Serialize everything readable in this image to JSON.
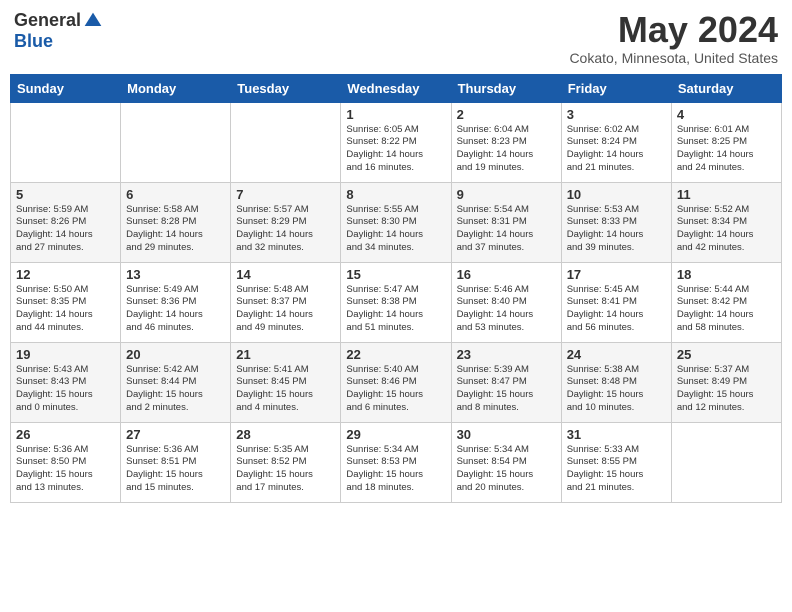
{
  "logo": {
    "general": "General",
    "blue": "Blue"
  },
  "header": {
    "month_title": "May 2024",
    "location": "Cokato, Minnesota, United States"
  },
  "days_of_week": [
    "Sunday",
    "Monday",
    "Tuesday",
    "Wednesday",
    "Thursday",
    "Friday",
    "Saturday"
  ],
  "weeks": [
    [
      {
        "day": "",
        "info": ""
      },
      {
        "day": "",
        "info": ""
      },
      {
        "day": "",
        "info": ""
      },
      {
        "day": "1",
        "info": "Sunrise: 6:05 AM\nSunset: 8:22 PM\nDaylight: 14 hours\nand 16 minutes."
      },
      {
        "day": "2",
        "info": "Sunrise: 6:04 AM\nSunset: 8:23 PM\nDaylight: 14 hours\nand 19 minutes."
      },
      {
        "day": "3",
        "info": "Sunrise: 6:02 AM\nSunset: 8:24 PM\nDaylight: 14 hours\nand 21 minutes."
      },
      {
        "day": "4",
        "info": "Sunrise: 6:01 AM\nSunset: 8:25 PM\nDaylight: 14 hours\nand 24 minutes."
      }
    ],
    [
      {
        "day": "5",
        "info": "Sunrise: 5:59 AM\nSunset: 8:26 PM\nDaylight: 14 hours\nand 27 minutes."
      },
      {
        "day": "6",
        "info": "Sunrise: 5:58 AM\nSunset: 8:28 PM\nDaylight: 14 hours\nand 29 minutes."
      },
      {
        "day": "7",
        "info": "Sunrise: 5:57 AM\nSunset: 8:29 PM\nDaylight: 14 hours\nand 32 minutes."
      },
      {
        "day": "8",
        "info": "Sunrise: 5:55 AM\nSunset: 8:30 PM\nDaylight: 14 hours\nand 34 minutes."
      },
      {
        "day": "9",
        "info": "Sunrise: 5:54 AM\nSunset: 8:31 PM\nDaylight: 14 hours\nand 37 minutes."
      },
      {
        "day": "10",
        "info": "Sunrise: 5:53 AM\nSunset: 8:33 PM\nDaylight: 14 hours\nand 39 minutes."
      },
      {
        "day": "11",
        "info": "Sunrise: 5:52 AM\nSunset: 8:34 PM\nDaylight: 14 hours\nand 42 minutes."
      }
    ],
    [
      {
        "day": "12",
        "info": "Sunrise: 5:50 AM\nSunset: 8:35 PM\nDaylight: 14 hours\nand 44 minutes."
      },
      {
        "day": "13",
        "info": "Sunrise: 5:49 AM\nSunset: 8:36 PM\nDaylight: 14 hours\nand 46 minutes."
      },
      {
        "day": "14",
        "info": "Sunrise: 5:48 AM\nSunset: 8:37 PM\nDaylight: 14 hours\nand 49 minutes."
      },
      {
        "day": "15",
        "info": "Sunrise: 5:47 AM\nSunset: 8:38 PM\nDaylight: 14 hours\nand 51 minutes."
      },
      {
        "day": "16",
        "info": "Sunrise: 5:46 AM\nSunset: 8:40 PM\nDaylight: 14 hours\nand 53 minutes."
      },
      {
        "day": "17",
        "info": "Sunrise: 5:45 AM\nSunset: 8:41 PM\nDaylight: 14 hours\nand 56 minutes."
      },
      {
        "day": "18",
        "info": "Sunrise: 5:44 AM\nSunset: 8:42 PM\nDaylight: 14 hours\nand 58 minutes."
      }
    ],
    [
      {
        "day": "19",
        "info": "Sunrise: 5:43 AM\nSunset: 8:43 PM\nDaylight: 15 hours\nand 0 minutes."
      },
      {
        "day": "20",
        "info": "Sunrise: 5:42 AM\nSunset: 8:44 PM\nDaylight: 15 hours\nand 2 minutes."
      },
      {
        "day": "21",
        "info": "Sunrise: 5:41 AM\nSunset: 8:45 PM\nDaylight: 15 hours\nand 4 minutes."
      },
      {
        "day": "22",
        "info": "Sunrise: 5:40 AM\nSunset: 8:46 PM\nDaylight: 15 hours\nand 6 minutes."
      },
      {
        "day": "23",
        "info": "Sunrise: 5:39 AM\nSunset: 8:47 PM\nDaylight: 15 hours\nand 8 minutes."
      },
      {
        "day": "24",
        "info": "Sunrise: 5:38 AM\nSunset: 8:48 PM\nDaylight: 15 hours\nand 10 minutes."
      },
      {
        "day": "25",
        "info": "Sunrise: 5:37 AM\nSunset: 8:49 PM\nDaylight: 15 hours\nand 12 minutes."
      }
    ],
    [
      {
        "day": "26",
        "info": "Sunrise: 5:36 AM\nSunset: 8:50 PM\nDaylight: 15 hours\nand 13 minutes."
      },
      {
        "day": "27",
        "info": "Sunrise: 5:36 AM\nSunset: 8:51 PM\nDaylight: 15 hours\nand 15 minutes."
      },
      {
        "day": "28",
        "info": "Sunrise: 5:35 AM\nSunset: 8:52 PM\nDaylight: 15 hours\nand 17 minutes."
      },
      {
        "day": "29",
        "info": "Sunrise: 5:34 AM\nSunset: 8:53 PM\nDaylight: 15 hours\nand 18 minutes."
      },
      {
        "day": "30",
        "info": "Sunrise: 5:34 AM\nSunset: 8:54 PM\nDaylight: 15 hours\nand 20 minutes."
      },
      {
        "day": "31",
        "info": "Sunrise: 5:33 AM\nSunset: 8:55 PM\nDaylight: 15 hours\nand 21 minutes."
      },
      {
        "day": "",
        "info": ""
      }
    ]
  ]
}
